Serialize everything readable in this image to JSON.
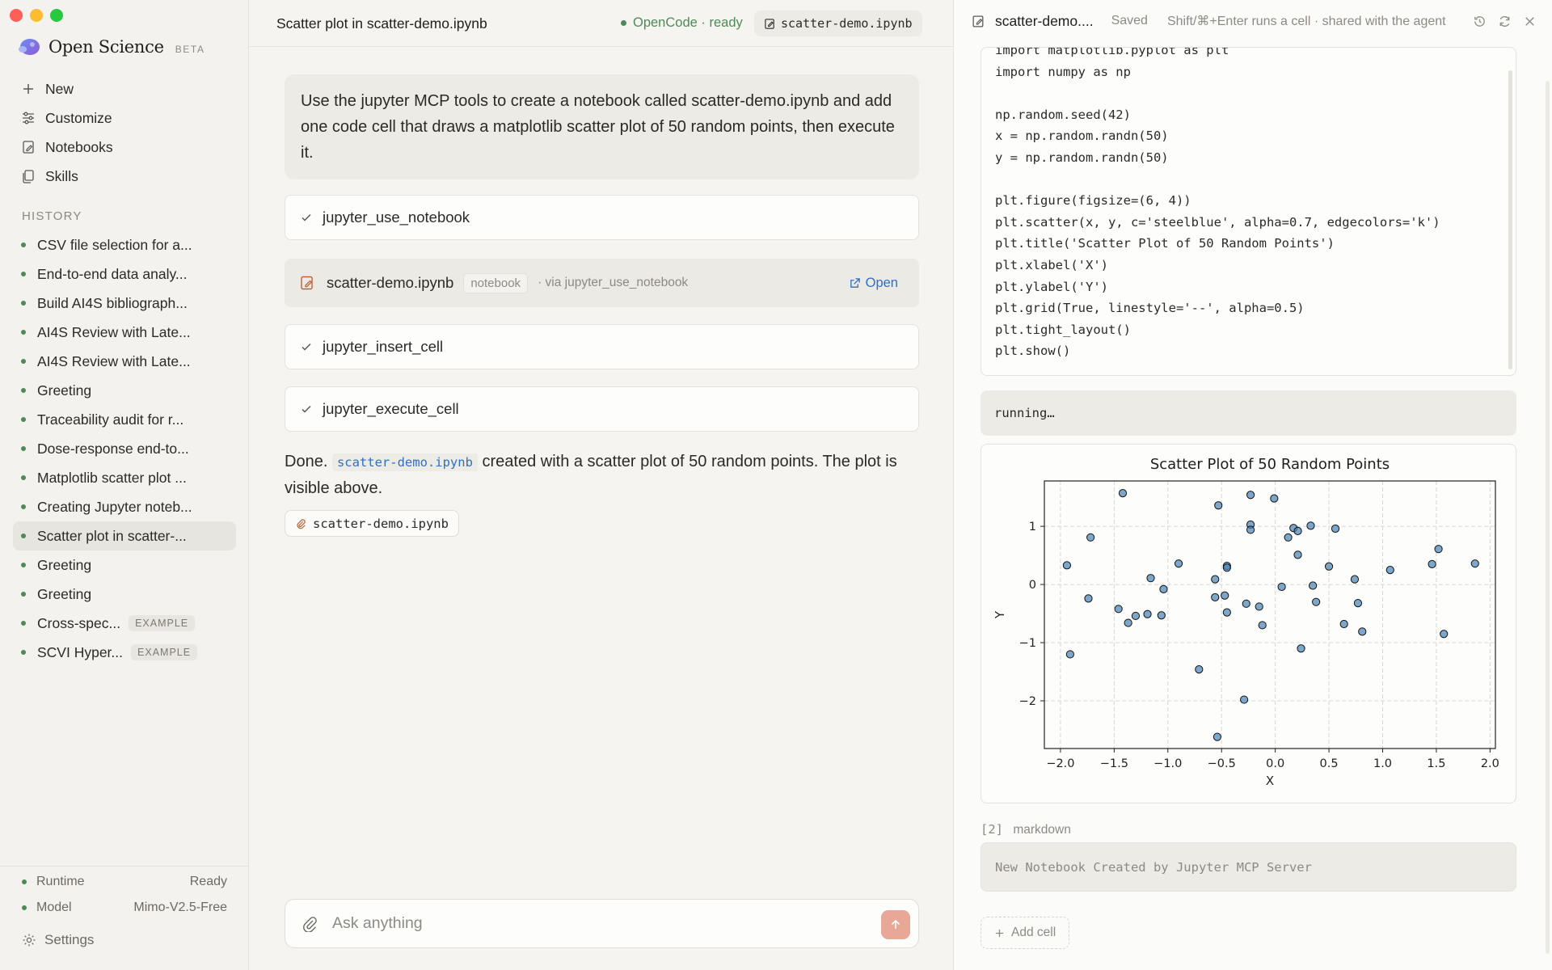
{
  "window": {
    "controls": [
      "close",
      "minimize",
      "zoom"
    ],
    "colors": {
      "close": "#ff5f57",
      "minimize": "#febc2e",
      "zoom": "#28c840"
    }
  },
  "brand": {
    "name": "Open Science",
    "badge": "BETA"
  },
  "nav": [
    {
      "label": "New",
      "icon": "plus-icon"
    },
    {
      "label": "Customize",
      "icon": "sliders-icon"
    },
    {
      "label": "Notebooks",
      "icon": "notebook-icon"
    },
    {
      "label": "Skills",
      "icon": "copy-icon"
    }
  ],
  "history": {
    "label": "HISTORY",
    "items": [
      {
        "label": "CSV file selection for a..."
      },
      {
        "label": "End-to-end data analy..."
      },
      {
        "label": "Build AI4S bibliograph..."
      },
      {
        "label": "AI4S Review with Late..."
      },
      {
        "label": "AI4S Review with Late..."
      },
      {
        "label": "Greeting"
      },
      {
        "label": "Traceability audit for r..."
      },
      {
        "label": "Dose-response end-to..."
      },
      {
        "label": "Matplotlib scatter plot ..."
      },
      {
        "label": "Creating Jupyter noteb..."
      },
      {
        "label": "Scatter plot in scatter-...",
        "active": true
      },
      {
        "label": "Greeting"
      },
      {
        "label": "Greeting"
      },
      {
        "label": "Cross-spec...",
        "tag": "EXAMPLE"
      },
      {
        "label": "SCVI Hyper...",
        "tag": "EXAMPLE"
      }
    ]
  },
  "footer": {
    "runtime_label": "Runtime",
    "runtime_value": "Ready",
    "model_label": "Model",
    "model_value": "Mimo-V2.5-Free",
    "settings_label": "Settings"
  },
  "chat": {
    "title": "Scatter plot in scatter-demo.ipynb",
    "status": "OpenCode · ready",
    "file_pill": "scatter-demo.ipynb",
    "user_message": "Use the jupyter MCP tools to create a notebook called scatter-demo.ipynb and add one code cell that draws a matplotlib scatter plot of 50 random points, then execute it.",
    "tool_calls": [
      "jupyter_use_notebook",
      "jupyter_insert_cell",
      "jupyter_execute_cell"
    ],
    "notebook_card": {
      "name": "scatter-demo.ipynb",
      "badge": "notebook",
      "via": "· via jupyter_use_notebook",
      "open_label": "Open"
    },
    "reply": {
      "prefix": "Done.",
      "code": "scatter-demo.ipynb",
      "suffix": "created with a scatter plot of 50 random points. The plot is visible above."
    },
    "attachment": "scatter-demo.ipynb",
    "composer_placeholder": "Ask anything",
    "accent": "#e9a797"
  },
  "notebook": {
    "filename": "scatter-demo....",
    "saved": "Saved",
    "hint": "Shift/⌘+Enter runs a cell · shared with the agent",
    "code": "import matplotlib.pyplot as plt\nimport numpy as np\n\nnp.random.seed(42)\nx = np.random.randn(50)\ny = np.random.randn(50)\n\nplt.figure(figsize=(6, 4))\nplt.scatter(x, y, c='steelblue', alpha=0.7, edgecolors='k')\nplt.title('Scatter Plot of 50 Random Points')\nplt.xlabel('X')\nplt.ylabel('Y')\nplt.grid(True, linestyle='--', alpha=0.5)\nplt.tight_layout()\nplt.show()",
    "output_status": "running…",
    "md_index": "[2]",
    "md_type": "markdown",
    "md_content": "New Notebook Created by Jupyter MCP Server",
    "add_cell_label": "Add cell"
  },
  "chart_data": {
    "type": "scatter",
    "title": "Scatter Plot of 50 Random Points",
    "xlabel": "X",
    "ylabel": "Y",
    "xlim": [
      -2.15,
      2.05
    ],
    "ylim": [
      -2.82,
      1.78
    ],
    "xticks": [
      -2.0,
      -1.5,
      -1.0,
      -0.5,
      0.0,
      0.5,
      1.0,
      1.5,
      2.0
    ],
    "xtick_labels": [
      "−2.0",
      "−1.5",
      "−1.0",
      "−0.5",
      "0.0",
      "0.5",
      "1.0",
      "1.5",
      "2.0"
    ],
    "yticks": [
      -2,
      -1,
      0,
      1
    ],
    "ytick_labels": [
      "−2",
      "−1",
      "0",
      "1"
    ],
    "grid": true,
    "color": "#4682b4",
    "points": [
      [
        -1.42,
        1.57
      ],
      [
        -0.53,
        1.36
      ],
      [
        -0.23,
        1.54
      ],
      [
        -0.01,
        1.48
      ],
      [
        -1.72,
        0.81
      ],
      [
        -0.23,
        1.03
      ],
      [
        -0.23,
        0.94
      ],
      [
        0.17,
        0.97
      ],
      [
        0.21,
        0.92
      ],
      [
        0.33,
        1.01
      ],
      [
        0.56,
        0.96
      ],
      [
        0.12,
        0.81
      ],
      [
        1.52,
        0.61
      ],
      [
        -1.94,
        0.33
      ],
      [
        -1.16,
        0.11
      ],
      [
        -0.45,
        0.32
      ],
      [
        -0.45,
        0.29
      ],
      [
        -0.9,
        0.36
      ],
      [
        0.21,
        0.51
      ],
      [
        0.5,
        0.31
      ],
      [
        1.07,
        0.25
      ],
      [
        1.46,
        0.35
      ],
      [
        1.86,
        0.36
      ],
      [
        0.74,
        0.09
      ],
      [
        -0.56,
        0.09
      ],
      [
        -1.74,
        -0.24
      ],
      [
        -1.04,
        -0.08
      ],
      [
        -0.56,
        -0.22
      ],
      [
        -0.47,
        -0.19
      ],
      [
        0.06,
        -0.04
      ],
      [
        0.35,
        -0.02
      ],
      [
        -1.46,
        -0.42
      ],
      [
        -0.27,
        -0.33
      ],
      [
        -0.15,
        -0.38
      ],
      [
        0.38,
        -0.3
      ],
      [
        0.77,
        -0.32
      ],
      [
        -1.37,
        -0.66
      ],
      [
        -1.3,
        -0.54
      ],
      [
        -1.19,
        -0.51
      ],
      [
        -1.06,
        -0.53
      ],
      [
        -0.45,
        -0.48
      ],
      [
        -0.12,
        -0.7
      ],
      [
        0.64,
        -0.68
      ],
      [
        0.81,
        -0.81
      ],
      [
        1.57,
        -0.85
      ],
      [
        -1.91,
        -1.2
      ],
      [
        0.24,
        -1.1
      ],
      [
        -0.71,
        -1.46
      ],
      [
        -0.29,
        -1.98
      ],
      [
        -0.54,
        -2.62
      ]
    ]
  }
}
